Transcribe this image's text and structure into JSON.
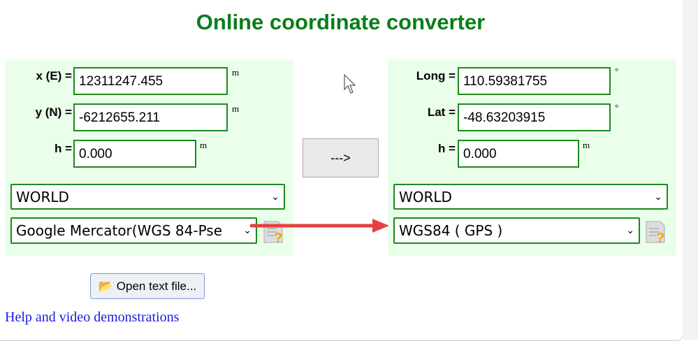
{
  "title": "Online coordinate converter",
  "source": {
    "x_label": "x (E) =",
    "x_value": "12311247.455",
    "x_unit": "m",
    "y_label": "y (N) =",
    "y_value": "-6212655.211",
    "y_unit": "m",
    "h_label": "h =",
    "h_value": "0.000",
    "h_unit": "m",
    "region": "WORLD",
    "system": "Google Mercator(WGS 84-Pse"
  },
  "target": {
    "long_label": "Long =",
    "long_value": "110.59381755",
    "long_unit": "°",
    "lat_label": "Lat =",
    "lat_value": "-48.63203915",
    "lat_unit": "°",
    "h_label": "h =",
    "h_value": "0.000",
    "h_unit": "m",
    "region": "WORLD",
    "system": "WGS84 ( GPS )"
  },
  "convert_label": "--->",
  "open_file_label": "Open text file...",
  "help_link": "Help and video demonstrations",
  "colors": {
    "title": "#0a7d1a",
    "panel": "#eaffea",
    "arrow": "#e84040"
  }
}
